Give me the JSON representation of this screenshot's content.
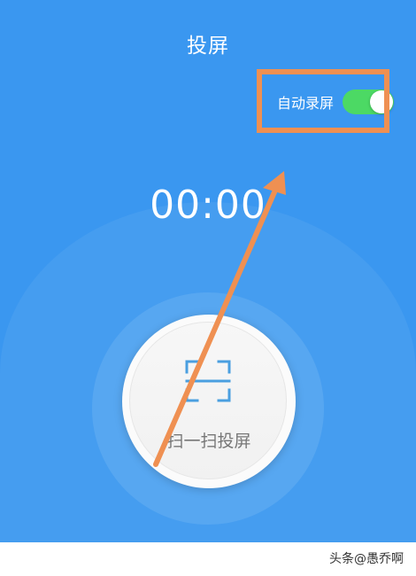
{
  "header": {
    "title": "投屏"
  },
  "auto_record": {
    "label": "自动录屏",
    "enabled": true
  },
  "timer": {
    "value": "00:00"
  },
  "scan_button": {
    "label": "扫一扫投屏",
    "icon": "scan-icon"
  },
  "watermark": {
    "text": "头条@愚乔啊"
  },
  "colors": {
    "background": "#3a97f0",
    "toggle_on": "#4cd964",
    "annotation": "#ef9052",
    "scan_icon": "#4a9fe0"
  }
}
